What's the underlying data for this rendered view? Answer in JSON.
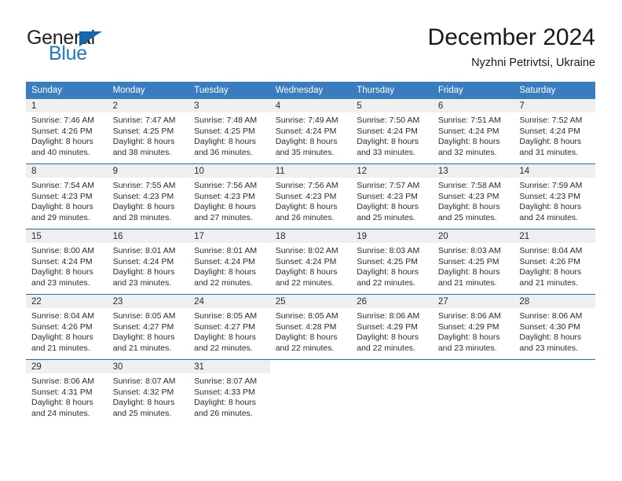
{
  "brand": {
    "name_part1": "General",
    "name_part2": "Blue",
    "triangle_icon": "triangle-icon",
    "color_dark": "#231f20",
    "color_blue": "#1f78c1"
  },
  "header": {
    "month_title": "December 2024",
    "location": "Nyzhni Petrivtsi, Ukraine"
  },
  "calendar": {
    "header_bg": "#3a7cc0",
    "daynum_bg": "#efefef",
    "row_border": "#1f6eb5",
    "weekdays": [
      "Sunday",
      "Monday",
      "Tuesday",
      "Wednesday",
      "Thursday",
      "Friday",
      "Saturday"
    ],
    "weeks": [
      [
        {
          "day": "1",
          "sunrise": "Sunrise: 7:46 AM",
          "sunset": "Sunset: 4:26 PM",
          "daylight_line1": "Daylight: 8 hours",
          "daylight_line2": "and 40 minutes."
        },
        {
          "day": "2",
          "sunrise": "Sunrise: 7:47 AM",
          "sunset": "Sunset: 4:25 PM",
          "daylight_line1": "Daylight: 8 hours",
          "daylight_line2": "and 38 minutes."
        },
        {
          "day": "3",
          "sunrise": "Sunrise: 7:48 AM",
          "sunset": "Sunset: 4:25 PM",
          "daylight_line1": "Daylight: 8 hours",
          "daylight_line2": "and 36 minutes."
        },
        {
          "day": "4",
          "sunrise": "Sunrise: 7:49 AM",
          "sunset": "Sunset: 4:24 PM",
          "daylight_line1": "Daylight: 8 hours",
          "daylight_line2": "and 35 minutes."
        },
        {
          "day": "5",
          "sunrise": "Sunrise: 7:50 AM",
          "sunset": "Sunset: 4:24 PM",
          "daylight_line1": "Daylight: 8 hours",
          "daylight_line2": "and 33 minutes."
        },
        {
          "day": "6",
          "sunrise": "Sunrise: 7:51 AM",
          "sunset": "Sunset: 4:24 PM",
          "daylight_line1": "Daylight: 8 hours",
          "daylight_line2": "and 32 minutes."
        },
        {
          "day": "7",
          "sunrise": "Sunrise: 7:52 AM",
          "sunset": "Sunset: 4:24 PM",
          "daylight_line1": "Daylight: 8 hours",
          "daylight_line2": "and 31 minutes."
        }
      ],
      [
        {
          "day": "8",
          "sunrise": "Sunrise: 7:54 AM",
          "sunset": "Sunset: 4:23 PM",
          "daylight_line1": "Daylight: 8 hours",
          "daylight_line2": "and 29 minutes."
        },
        {
          "day": "9",
          "sunrise": "Sunrise: 7:55 AM",
          "sunset": "Sunset: 4:23 PM",
          "daylight_line1": "Daylight: 8 hours",
          "daylight_line2": "and 28 minutes."
        },
        {
          "day": "10",
          "sunrise": "Sunrise: 7:56 AM",
          "sunset": "Sunset: 4:23 PM",
          "daylight_line1": "Daylight: 8 hours",
          "daylight_line2": "and 27 minutes."
        },
        {
          "day": "11",
          "sunrise": "Sunrise: 7:56 AM",
          "sunset": "Sunset: 4:23 PM",
          "daylight_line1": "Daylight: 8 hours",
          "daylight_line2": "and 26 minutes."
        },
        {
          "day": "12",
          "sunrise": "Sunrise: 7:57 AM",
          "sunset": "Sunset: 4:23 PM",
          "daylight_line1": "Daylight: 8 hours",
          "daylight_line2": "and 25 minutes."
        },
        {
          "day": "13",
          "sunrise": "Sunrise: 7:58 AM",
          "sunset": "Sunset: 4:23 PM",
          "daylight_line1": "Daylight: 8 hours",
          "daylight_line2": "and 25 minutes."
        },
        {
          "day": "14",
          "sunrise": "Sunrise: 7:59 AM",
          "sunset": "Sunset: 4:23 PM",
          "daylight_line1": "Daylight: 8 hours",
          "daylight_line2": "and 24 minutes."
        }
      ],
      [
        {
          "day": "15",
          "sunrise": "Sunrise: 8:00 AM",
          "sunset": "Sunset: 4:24 PM",
          "daylight_line1": "Daylight: 8 hours",
          "daylight_line2": "and 23 minutes."
        },
        {
          "day": "16",
          "sunrise": "Sunrise: 8:01 AM",
          "sunset": "Sunset: 4:24 PM",
          "daylight_line1": "Daylight: 8 hours",
          "daylight_line2": "and 23 minutes."
        },
        {
          "day": "17",
          "sunrise": "Sunrise: 8:01 AM",
          "sunset": "Sunset: 4:24 PM",
          "daylight_line1": "Daylight: 8 hours",
          "daylight_line2": "and 22 minutes."
        },
        {
          "day": "18",
          "sunrise": "Sunrise: 8:02 AM",
          "sunset": "Sunset: 4:24 PM",
          "daylight_line1": "Daylight: 8 hours",
          "daylight_line2": "and 22 minutes."
        },
        {
          "day": "19",
          "sunrise": "Sunrise: 8:03 AM",
          "sunset": "Sunset: 4:25 PM",
          "daylight_line1": "Daylight: 8 hours",
          "daylight_line2": "and 22 minutes."
        },
        {
          "day": "20",
          "sunrise": "Sunrise: 8:03 AM",
          "sunset": "Sunset: 4:25 PM",
          "daylight_line1": "Daylight: 8 hours",
          "daylight_line2": "and 21 minutes."
        },
        {
          "day": "21",
          "sunrise": "Sunrise: 8:04 AM",
          "sunset": "Sunset: 4:26 PM",
          "daylight_line1": "Daylight: 8 hours",
          "daylight_line2": "and 21 minutes."
        }
      ],
      [
        {
          "day": "22",
          "sunrise": "Sunrise: 8:04 AM",
          "sunset": "Sunset: 4:26 PM",
          "daylight_line1": "Daylight: 8 hours",
          "daylight_line2": "and 21 minutes."
        },
        {
          "day": "23",
          "sunrise": "Sunrise: 8:05 AM",
          "sunset": "Sunset: 4:27 PM",
          "daylight_line1": "Daylight: 8 hours",
          "daylight_line2": "and 21 minutes."
        },
        {
          "day": "24",
          "sunrise": "Sunrise: 8:05 AM",
          "sunset": "Sunset: 4:27 PM",
          "daylight_line1": "Daylight: 8 hours",
          "daylight_line2": "and 22 minutes."
        },
        {
          "day": "25",
          "sunrise": "Sunrise: 8:05 AM",
          "sunset": "Sunset: 4:28 PM",
          "daylight_line1": "Daylight: 8 hours",
          "daylight_line2": "and 22 minutes."
        },
        {
          "day": "26",
          "sunrise": "Sunrise: 8:06 AM",
          "sunset": "Sunset: 4:29 PM",
          "daylight_line1": "Daylight: 8 hours",
          "daylight_line2": "and 22 minutes."
        },
        {
          "day": "27",
          "sunrise": "Sunrise: 8:06 AM",
          "sunset": "Sunset: 4:29 PM",
          "daylight_line1": "Daylight: 8 hours",
          "daylight_line2": "and 23 minutes."
        },
        {
          "day": "28",
          "sunrise": "Sunrise: 8:06 AM",
          "sunset": "Sunset: 4:30 PM",
          "daylight_line1": "Daylight: 8 hours",
          "daylight_line2": "and 23 minutes."
        }
      ],
      [
        {
          "day": "29",
          "sunrise": "Sunrise: 8:06 AM",
          "sunset": "Sunset: 4:31 PM",
          "daylight_line1": "Daylight: 8 hours",
          "daylight_line2": "and 24 minutes."
        },
        {
          "day": "30",
          "sunrise": "Sunrise: 8:07 AM",
          "sunset": "Sunset: 4:32 PM",
          "daylight_line1": "Daylight: 8 hours",
          "daylight_line2": "and 25 minutes."
        },
        {
          "day": "31",
          "sunrise": "Sunrise: 8:07 AM",
          "sunset": "Sunset: 4:33 PM",
          "daylight_line1": "Daylight: 8 hours",
          "daylight_line2": "and 26 minutes."
        },
        {
          "day": "",
          "sunrise": "",
          "sunset": "",
          "daylight_line1": "",
          "daylight_line2": ""
        },
        {
          "day": "",
          "sunrise": "",
          "sunset": "",
          "daylight_line1": "",
          "daylight_line2": ""
        },
        {
          "day": "",
          "sunrise": "",
          "sunset": "",
          "daylight_line1": "",
          "daylight_line2": ""
        },
        {
          "day": "",
          "sunrise": "",
          "sunset": "",
          "daylight_line1": "",
          "daylight_line2": ""
        }
      ]
    ]
  }
}
